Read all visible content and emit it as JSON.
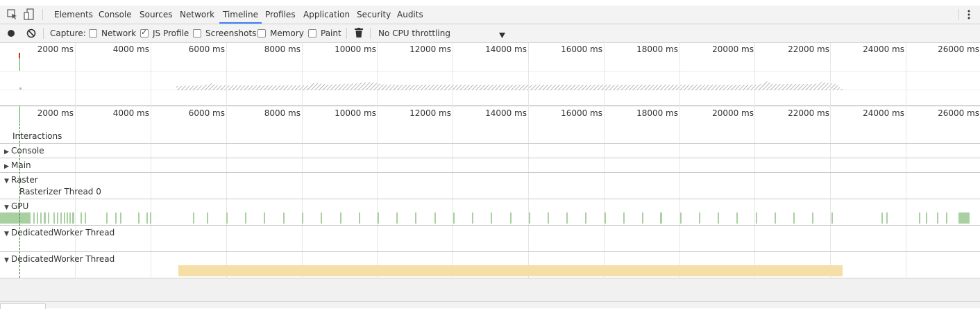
{
  "tabs": [
    "Elements",
    "Console",
    "Sources",
    "Network",
    "Timeline",
    "Profiles",
    "Application",
    "Security",
    "Audits"
  ],
  "active_tab": "Timeline",
  "toolbar": {
    "capture_label": "Capture:",
    "options": [
      {
        "label": "Network",
        "checked": false
      },
      {
        "label": "JS Profile",
        "checked": true
      },
      {
        "label": "Screenshots",
        "checked": false
      },
      {
        "label": "Memory",
        "checked": false
      },
      {
        "label": "Paint",
        "checked": false
      }
    ],
    "throttling": "No CPU throttling"
  },
  "ruler": {
    "labels": [
      "2000 ms",
      "4000 ms",
      "6000 ms",
      "8000 ms",
      "10000 ms",
      "12000 ms",
      "14000 ms",
      "16000 ms",
      "18000 ms",
      "20000 ms",
      "22000 ms",
      "24000 ms",
      "26000 ms"
    ]
  },
  "tracks": {
    "interactions": "Interactions",
    "console": "Console",
    "main": "Main",
    "raster": "Raster",
    "rasterizer_thread": "Rasterizer Thread 0",
    "gpu": "GPU",
    "worker1": "DedicatedWorker Thread",
    "worker2": "DedicatedWorker Thread"
  },
  "colors": {
    "accent": "#3e82f7",
    "gpu": "#a9d0a1",
    "worker_activity": "#f5dfa6",
    "frame_marker": "#4caf50",
    "red_marker": "#d93025"
  },
  "icons": [
    "select-element-icon",
    "device-mode-icon",
    "record-icon",
    "clear-icon",
    "trash-icon",
    "dropdown-arrow-icon",
    "more-menu-icon"
  ]
}
